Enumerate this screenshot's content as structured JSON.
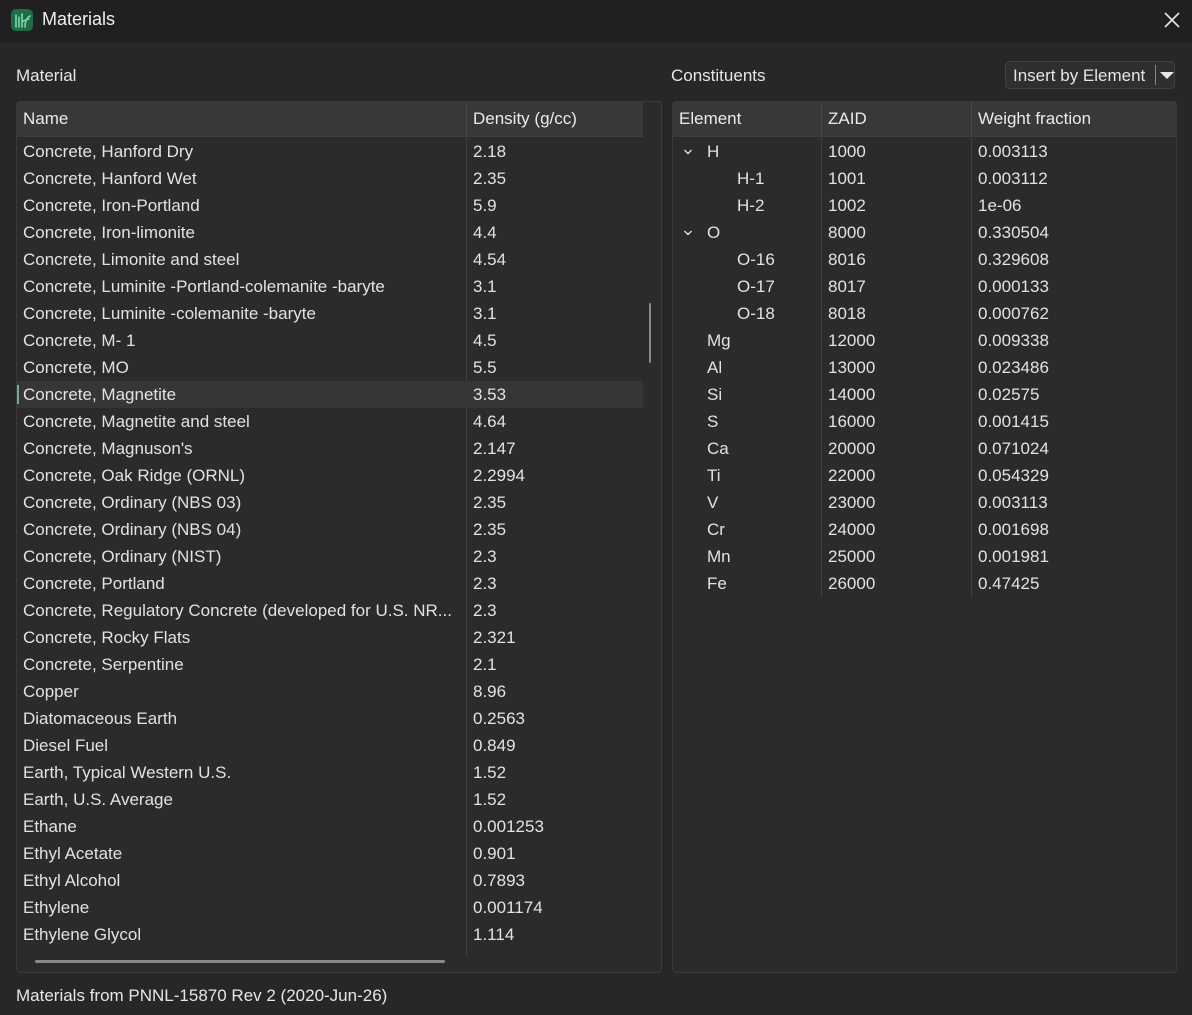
{
  "window": {
    "title": "Materials",
    "icon": "leaf-app-icon",
    "close": "close-icon"
  },
  "material": {
    "label": "Material",
    "columns": [
      "Name",
      "Density (g/cc)"
    ],
    "selected_index": 9,
    "rows": [
      {
        "name": "Concrete, Hanford Dry",
        "density": "2.18"
      },
      {
        "name": "Concrete, Hanford Wet",
        "density": "2.35"
      },
      {
        "name": "Concrete, Iron-Portland",
        "density": "5.9"
      },
      {
        "name": "Concrete, Iron-limonite",
        "density": "4.4"
      },
      {
        "name": "Concrete, Limonite and steel",
        "density": "4.54"
      },
      {
        "name": "Concrete, Luminite -Portland-colemanite -baryte",
        "density": "3.1"
      },
      {
        "name": "Concrete, Luminite -colemanite -baryte",
        "density": "3.1"
      },
      {
        "name": "Concrete, M- 1",
        "density": "4.5"
      },
      {
        "name": "Concrete, MO",
        "density": "5.5"
      },
      {
        "name": "Concrete, Magnetite",
        "density": "3.53"
      },
      {
        "name": "Concrete, Magnetite and steel",
        "density": "4.64"
      },
      {
        "name": "Concrete, Magnuson's",
        "density": "2.147"
      },
      {
        "name": "Concrete, Oak Ridge (ORNL)",
        "density": "2.2994"
      },
      {
        "name": "Concrete, Ordinary (NBS 03)",
        "density": "2.35"
      },
      {
        "name": "Concrete, Ordinary (NBS 04)",
        "density": "2.35"
      },
      {
        "name": "Concrete, Ordinary (NIST)",
        "density": "2.3"
      },
      {
        "name": "Concrete, Portland",
        "density": "2.3"
      },
      {
        "name": "Concrete, Regulatory Concrete (developed for U.S. NR...",
        "density": "2.3"
      },
      {
        "name": "Concrete, Rocky Flats",
        "density": "2.321"
      },
      {
        "name": "Concrete, Serpentine",
        "density": "2.1"
      },
      {
        "name": "Copper",
        "density": "8.96"
      },
      {
        "name": "Diatomaceous Earth",
        "density": "0.2563"
      },
      {
        "name": "Diesel Fuel",
        "density": "0.849"
      },
      {
        "name": "Earth, Typical Western U.S.",
        "density": "1.52"
      },
      {
        "name": "Earth, U.S. Average",
        "density": "1.52"
      },
      {
        "name": "Ethane",
        "density": "0.001253"
      },
      {
        "name": "Ethyl Acetate",
        "density": "0.901"
      },
      {
        "name": "Ethyl Alcohol",
        "density": "0.7893"
      },
      {
        "name": "Ethylene",
        "density": "0.001174"
      },
      {
        "name": "Ethylene Glycol",
        "density": "1.114"
      }
    ]
  },
  "constituents": {
    "label": "Constituents",
    "insert_button": "Insert by Element",
    "columns": [
      "Element",
      "ZAID",
      "Weight fraction"
    ],
    "rows": [
      {
        "element": "H",
        "zaid": "1000",
        "weight": "0.003113",
        "level": 0,
        "expanded": true
      },
      {
        "element": "H-1",
        "zaid": "1001",
        "weight": "0.003112",
        "level": 1
      },
      {
        "element": "H-2",
        "zaid": "1002",
        "weight": "1e-06",
        "level": 1
      },
      {
        "element": "O",
        "zaid": "8000",
        "weight": "0.330504",
        "level": 0,
        "expanded": true
      },
      {
        "element": "O-16",
        "zaid": "8016",
        "weight": "0.329608",
        "level": 1
      },
      {
        "element": "O-17",
        "zaid": "8017",
        "weight": "0.000133",
        "level": 1
      },
      {
        "element": "O-18",
        "zaid": "8018",
        "weight": "0.000762",
        "level": 1
      },
      {
        "element": "Mg",
        "zaid": "12000",
        "weight": "0.009338",
        "level": 0
      },
      {
        "element": "Al",
        "zaid": "13000",
        "weight": "0.023486",
        "level": 0
      },
      {
        "element": "Si",
        "zaid": "14000",
        "weight": "0.02575",
        "level": 0
      },
      {
        "element": "S",
        "zaid": "16000",
        "weight": "0.001415",
        "level": 0
      },
      {
        "element": "Ca",
        "zaid": "20000",
        "weight": "0.071024",
        "level": 0
      },
      {
        "element": "Ti",
        "zaid": "22000",
        "weight": "0.054329",
        "level": 0
      },
      {
        "element": "V",
        "zaid": "23000",
        "weight": "0.003113",
        "level": 0
      },
      {
        "element": "Cr",
        "zaid": "24000",
        "weight": "0.001698",
        "level": 0
      },
      {
        "element": "Mn",
        "zaid": "25000",
        "weight": "0.001981",
        "level": 0
      },
      {
        "element": "Fe",
        "zaid": "26000",
        "weight": "0.47425",
        "level": 0
      }
    ]
  },
  "status": "Materials from PNNL-15870 Rev 2 (2020-Jun-26)",
  "colors": {
    "background": "#272727",
    "header": "#383838",
    "selection_marker": "#6fae8d"
  }
}
